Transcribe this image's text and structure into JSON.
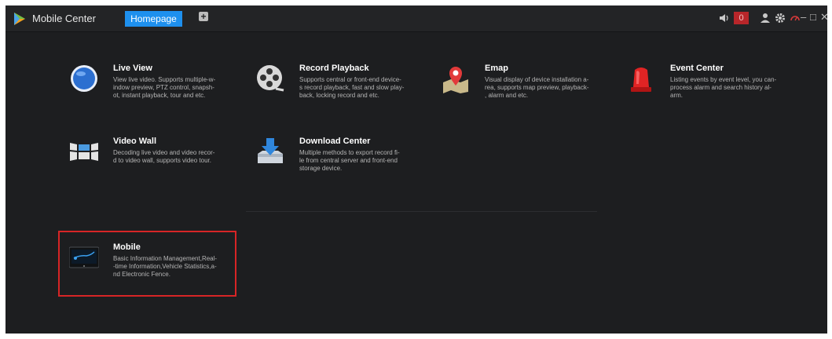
{
  "app": {
    "title": "Mobile Center"
  },
  "tabs": [
    {
      "label": "Homepage",
      "active": true
    }
  ],
  "add_tab_icon": "plus-icon",
  "alarm": {
    "count": "0"
  },
  "window_controls": {
    "minimize": "–",
    "maximize": "□",
    "close": "✕"
  },
  "colors": {
    "accent": "#1e90ee",
    "highlight": "#d72526",
    "background": "#1d1e20",
    "alarm": "#b8262a"
  },
  "modules": [
    {
      "title": "Live View",
      "icon": "live-view-icon",
      "description": "View live video. Supports multiple-w-\nindow preview, PTZ control, snapsh-\not, instant playback, tour and etc."
    },
    {
      "title": "Record Playback",
      "icon": "film-reel-icon",
      "description": "Supports central or front-end device-\ns record playback, fast and slow play-\nback, locking record and etc."
    },
    {
      "title": "Emap",
      "icon": "map-pin-icon",
      "description": "Visual display of device installation a-\nrea, supports map preview, playback-\n, alarm and etc."
    },
    {
      "title": "Event Center",
      "icon": "alarm-light-icon",
      "description": "Listing events by event level, you can-\n process alarm and search history al-\narm."
    },
    {
      "title": "Video Wall",
      "icon": "video-wall-icon",
      "description": "Decoding live video and video recor-\nd to video wall, supports video tour."
    },
    {
      "title": "Download Center",
      "icon": "download-icon",
      "description": "Multiple methods to export record fi-\nle from central server and front-end\nstorage device."
    },
    {
      "title": "Mobile",
      "icon": "mobile-device-icon",
      "description": "Basic Information Management,Real-\n-time Information,Vehicle Statistics,a-\nnd Electronic Fence."
    }
  ]
}
